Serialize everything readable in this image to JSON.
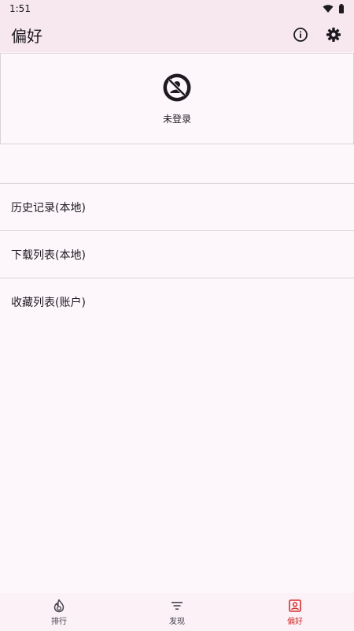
{
  "status_bar": {
    "time": "1:51",
    "icons": [
      "wifi-icon",
      "battery-icon"
    ]
  },
  "app_bar": {
    "title": "偏好",
    "actions": [
      "info-icon",
      "settings-gear-icon"
    ]
  },
  "profile": {
    "avatar_icon": "no-login-avatar-icon",
    "status_label": "未登录"
  },
  "menu": {
    "items": [
      {
        "label": "历史记录(本地)"
      },
      {
        "label": "下载列表(本地)"
      },
      {
        "label": "收藏列表(账户)"
      }
    ]
  },
  "bottom_nav": {
    "items": [
      {
        "label": "排行",
        "icon": "flame-icon",
        "active": false
      },
      {
        "label": "发现",
        "icon": "filter-icon",
        "active": false
      },
      {
        "label": "偏好",
        "icon": "account-box-icon",
        "active": true
      }
    ],
    "active_color": "#d32f2f"
  }
}
